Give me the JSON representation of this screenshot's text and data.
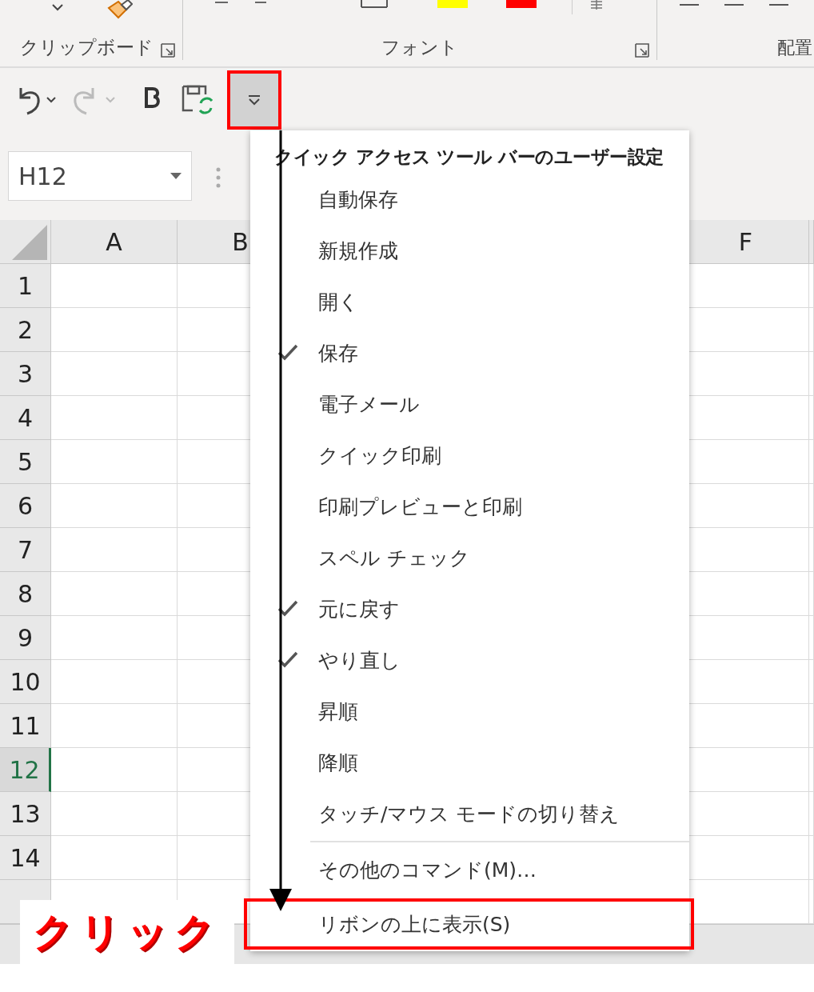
{
  "ribbon": {
    "groups": [
      {
        "label": "クリップボード"
      },
      {
        "label": "フォント"
      },
      {
        "label": "配置"
      }
    ]
  },
  "quick_access_toolbar": {
    "customize_button": {
      "highlighted": true
    }
  },
  "name_box": {
    "value": "H12"
  },
  "sheet": {
    "columns_left": [
      "A",
      "B"
    ],
    "columns_right": [
      "F"
    ],
    "rows": [
      {
        "label": "1",
        "selected": false
      },
      {
        "label": "2",
        "selected": false
      },
      {
        "label": "3",
        "selected": false
      },
      {
        "label": "4",
        "selected": false
      },
      {
        "label": "5",
        "selected": false
      },
      {
        "label": "6",
        "selected": false
      },
      {
        "label": "7",
        "selected": false
      },
      {
        "label": "8",
        "selected": false
      },
      {
        "label": "9",
        "selected": false
      },
      {
        "label": "10",
        "selected": false
      },
      {
        "label": "11",
        "selected": false
      },
      {
        "label": "12",
        "selected": true
      },
      {
        "label": "13",
        "selected": false
      },
      {
        "label": "14",
        "selected": false
      }
    ]
  },
  "menu": {
    "title": "クイック アクセス ツール バーのユーザー設定",
    "items": [
      {
        "label": "自動保存",
        "checked": false
      },
      {
        "label": "新規作成",
        "checked": false
      },
      {
        "label": "開く",
        "checked": false
      },
      {
        "label": "保存",
        "checked": true
      },
      {
        "label": "電子メール",
        "checked": false
      },
      {
        "label": "クイック印刷",
        "checked": false
      },
      {
        "label": "印刷プレビューと印刷",
        "checked": false
      },
      {
        "label": "スペル チェック",
        "checked": false
      },
      {
        "label": "元に戻す",
        "checked": true
      },
      {
        "label": "やり直し",
        "checked": true
      },
      {
        "label": "昇順",
        "checked": false
      },
      {
        "label": "降順",
        "checked": false
      },
      {
        "label": "タッチ/マウス モードの切り替え",
        "checked": false
      }
    ],
    "commands": [
      {
        "label": "その他のコマンド(M)…",
        "highlighted": false
      },
      {
        "label": "リボンの上に表示(S)",
        "highlighted": true
      }
    ]
  },
  "callout": {
    "text": "クリック"
  }
}
